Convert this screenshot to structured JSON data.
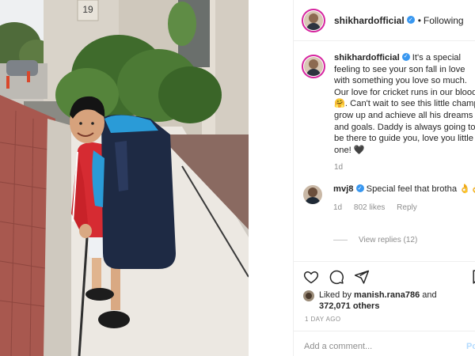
{
  "photo": {
    "house_number": "19"
  },
  "header": {
    "username": "shikhardofficial",
    "separator": "•",
    "follow_status": "Following"
  },
  "caption": {
    "username": "shikhardofficial",
    "text": "It's a special feeling to see your son fall in love with something you love so much. Our love for cricket runs in our blood 🤗. Can't wait to see this little champ grow up and achieve all his dreams and goals. Daddy is always going to be there to guide you, love you little one! 🖤",
    "time": "1d"
  },
  "comment": {
    "username": "mvj8",
    "text": "Special feel that brotha 👌👌",
    "time": "1d",
    "likes": "802 likes",
    "reply_label": "Reply",
    "view_replies": "View replies (12)"
  },
  "likes": {
    "prefix": "Liked by",
    "user": "manish.rana786",
    "and": "and",
    "others": "372,071 others"
  },
  "timestamp": "1 DAY AGO",
  "add_comment": {
    "placeholder": "Add a comment...",
    "post_label": "Post"
  },
  "icons": {
    "like": "heart-icon",
    "comment": "comment-icon",
    "share": "share-icon",
    "save": "bookmark-icon",
    "verified": "verified-badge-icon"
  },
  "colors": {
    "verified": "#3897f0",
    "muted": "#8e8e8e",
    "text": "#262626",
    "post_disabled": "#b3dbff"
  }
}
